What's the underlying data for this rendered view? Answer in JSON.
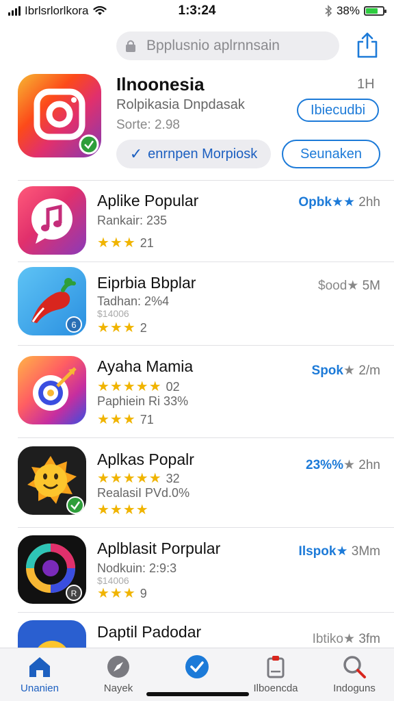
{
  "status_bar": {
    "carrier": "Ibrlsrlorlkora",
    "time": "1:3:24",
    "battery": "38%",
    "battery_level": 0.7
  },
  "search": {
    "placeholder": "Bpplusnio aplrnnsain"
  },
  "featured": {
    "title": "Ilnoonesia",
    "subtitle": "Rolpikasia Dnpdasak",
    "size": "Sorte: 2.98",
    "time": "1H",
    "get_label": "Ibiecudbi",
    "action_primary_label": "enrnpen Morpiosk",
    "action_secondary_label": "Seunaken"
  },
  "apps": [
    {
      "title": "Aplike Popular",
      "meta": "Rankair: 235",
      "sub": "",
      "stars_text": "★★★",
      "rating_count": "21",
      "right_link": "Opbk★★",
      "right_time": "2hh",
      "icon": "music-note-icon"
    },
    {
      "title": "Eiprbia Bbplar",
      "meta": "Tadhan: 2%4",
      "sub": "$14006",
      "stars_text": "★★★",
      "rating_count": "2",
      "right_link": "",
      "right_gray": "$ood★",
      "right_time": "5M",
      "icon": "pepper-icon"
    },
    {
      "title": "Ayaha Mamia",
      "meta": "Paphiein Ri 33%",
      "sub": "",
      "stars_top": "★★★★★",
      "stars_top_count": "02",
      "stars_text": "★★★",
      "rating_count": "71",
      "right_link": "Spok",
      "right_gray": "★",
      "right_time": "2/m",
      "icon": "target-arrow-icon"
    },
    {
      "title": "Aplkas Popalr",
      "meta": "RealasiI PVd.0%",
      "sub": "",
      "stars_top": "★★★★★",
      "stars_top_count": "32",
      "stars_text": "★★★★",
      "rating_count": "",
      "right_link": "23%%",
      "right_gray": "★",
      "right_time": "2hn",
      "icon": "emoji-sun-icon"
    },
    {
      "title": "Aplblasit Porpular",
      "meta": "Nodkuin: 2:9:3",
      "sub": "$14006",
      "stars_text": "★★★",
      "rating_count": "9",
      "right_link": "Ilspok★",
      "right_gray": "",
      "right_time": "3Mm",
      "icon": "ring-icon"
    },
    {
      "title": "Daptil Padodar",
      "meta": "",
      "sub": "",
      "stars_text": "",
      "rating_count": "",
      "right_link": "",
      "right_gray": "Ibtiko★",
      "right_time": "3fm",
      "icon": "emoji-icon"
    }
  ],
  "tabs": [
    {
      "label": "Unanien",
      "icon": "home-icon"
    },
    {
      "label": "Nayek",
      "icon": "compass-icon"
    },
    {
      "label": "",
      "icon": "check-circle-icon"
    },
    {
      "label": "Ilboencda",
      "icon": "clipboard-icon"
    },
    {
      "label": "Indoguns",
      "icon": "search-icon"
    }
  ],
  "colors": {
    "accent": "#1c7ad8",
    "star": "#f0b400"
  }
}
